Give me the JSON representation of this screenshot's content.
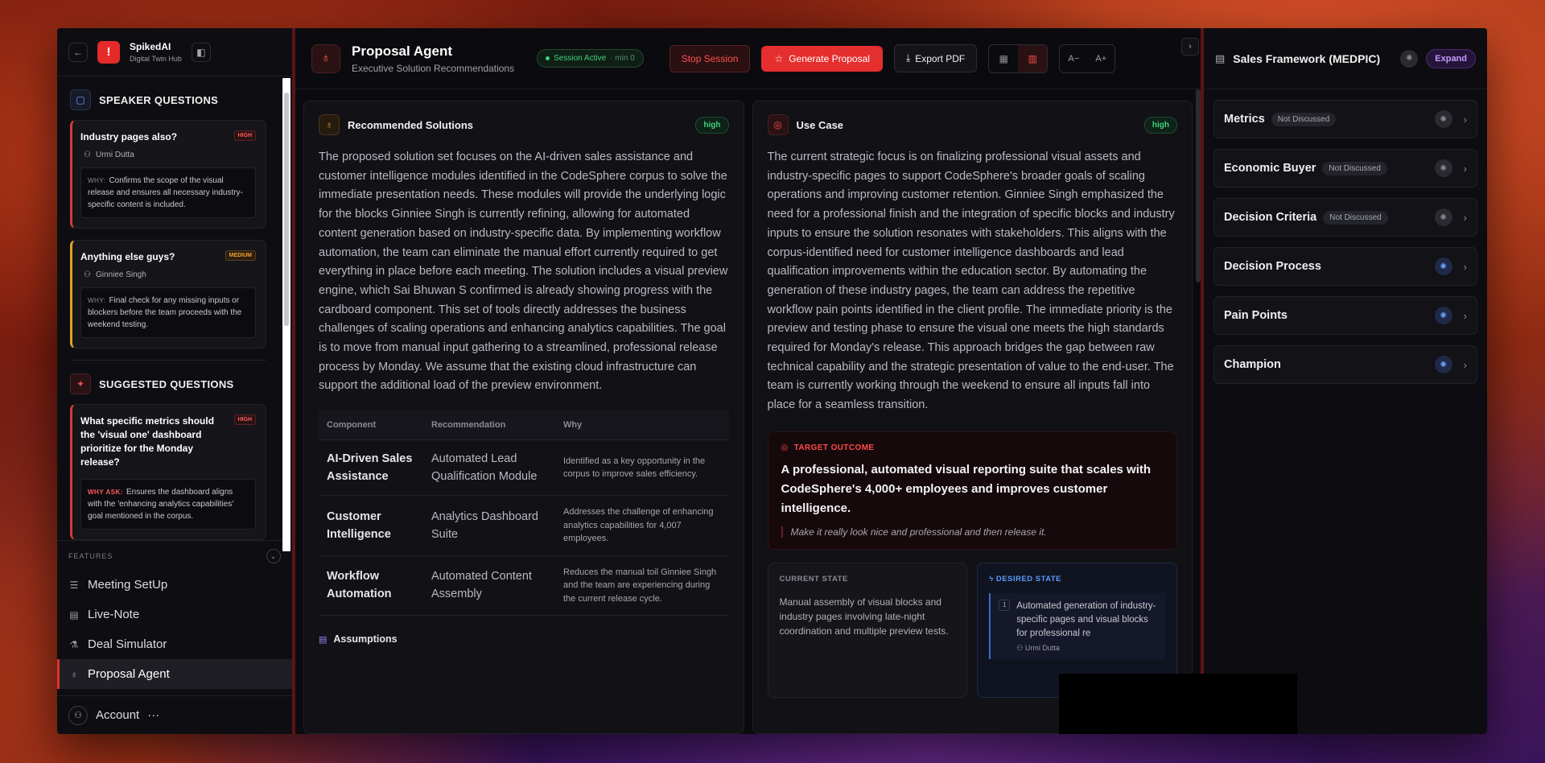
{
  "app": {
    "brand_name": "SpikedAI",
    "brand_sub": "Digital Twin Hub",
    "logo_glyph": "!"
  },
  "speaker_questions": {
    "title": "SPEAKER QUESTIONS",
    "items": [
      {
        "question": "Industry pages also?",
        "priority": "HIGH",
        "user": "Urmi Dutta",
        "why_label": "WHY:",
        "why": "Confirms the scope of the visual release and ensures all necessary industry-specific content is included."
      },
      {
        "question": "Anything else guys?",
        "priority": "MEDIUM",
        "user": "Ginniee Singh",
        "why_label": "WHY:",
        "why": "Final check for any missing inputs or blockers before the team proceeds with the weekend testing."
      }
    ]
  },
  "suggested_questions": {
    "title": "SUGGESTED QUESTIONS",
    "items": [
      {
        "question": "What specific metrics should the 'visual one' dashboard prioritize for the Monday release?",
        "priority": "HIGH",
        "why_label": "WHY ASK:",
        "why": "Ensures the dashboard aligns with the 'enhancing analytics capabilities' goal mentioned in the corpus."
      }
    ]
  },
  "features": {
    "label": "FEATURES",
    "items": [
      {
        "label": "Meeting SetUp",
        "icon": "database-icon"
      },
      {
        "label": "Live-Note",
        "icon": "message-icon"
      },
      {
        "label": "Deal Simulator",
        "icon": "flask-icon"
      },
      {
        "label": "Proposal Agent",
        "icon": "lightbulb-icon",
        "active": true
      }
    ]
  },
  "account": {
    "label": "Account",
    "more": "···"
  },
  "header": {
    "title": "Proposal Agent",
    "subtitle": "Executive Solution Recommendations",
    "session_status": "Session Active",
    "session_time": "· min 0",
    "stop_label": "Stop Session",
    "generate_label": "Generate Proposal",
    "export_label": "Export PDF",
    "font_decrease": "A−",
    "font_increase": "A+"
  },
  "recommended": {
    "title": "Recommended Solutions",
    "badge": "high",
    "paragraph": "The proposed solution set focuses on the AI-driven sales assistance and customer intelligence modules identified in the CodeSphere corpus to solve the immediate presentation needs. These modules will provide the underlying logic for the blocks Ginniee Singh is currently refining, allowing for automated content generation based on industry-specific data. By implementing workflow automation, the team can eliminate the manual effort currently required to get everything in place before each meeting. The solution includes a visual preview engine, which Sai Bhuwan S confirmed is already showing progress with the cardboard component. This set of tools directly addresses the business challenges of scaling operations and enhancing analytics capabilities. The goal is to move from manual input gathering to a streamlined, professional release process by Monday. We assume that the existing cloud infrastructure can support the additional load of the preview environment.",
    "table": {
      "headers": [
        "Component",
        "Recommendation",
        "Why"
      ],
      "rows": [
        {
          "component": "AI-Driven Sales Assistance",
          "recommendation": "Automated Lead Qualification Module",
          "why": "Identified as a key opportunity in the corpus to improve sales efficiency."
        },
        {
          "component": "Customer Intelligence",
          "recommendation": "Analytics Dashboard Suite",
          "why": "Addresses the challenge of enhancing analytics capabilities for 4,007 employees."
        },
        {
          "component": "Workflow Automation",
          "recommendation": "Automated Content Assembly",
          "why": "Reduces the manual toil Ginniee Singh and the team are experiencing during the current release cycle."
        }
      ]
    },
    "assumptions_label": "Assumptions"
  },
  "use_case": {
    "title": "Use Case",
    "badge": "high",
    "paragraph": "The current strategic focus is on finalizing professional visual assets and industry-specific pages to support CodeSphere's broader goals of scaling operations and improving customer retention. Ginniee Singh emphasized the need for a professional finish and the integration of specific blocks and industry inputs to ensure the solution resonates with stakeholders. This aligns with the corpus-identified need for customer intelligence dashboards and lead qualification improvements within the education sector. By automating the generation of these industry pages, the team can address the repetitive workflow pain points identified in the client profile. The immediate priority is the preview and testing phase to ensure the visual one meets the high standards required for Monday's release. This approach bridges the gap between raw technical capability and the strategic presentation of value to the end-user. The team is currently working through the weekend to ensure all inputs fall into place for a seamless transition.",
    "target_label": "TARGET OUTCOME",
    "target_text": "A professional, automated visual reporting suite that scales with CodeSphere's 4,000+ employees and improves customer intelligence.",
    "target_quote": "Make it really look nice and professional and then release it.",
    "current_label": "CURRENT STATE",
    "current_text": "Manual assembly of visual blocks and industry pages involving late-night coordination and multiple preview tests.",
    "desired_label": "DESIRED STATE",
    "desired_item_num": "1",
    "desired_item_text": "Automated generation of industry-specific pages and visual blocks for professional re",
    "desired_item_user": "Urmi Dutta"
  },
  "framework": {
    "title": "Sales Framework (MEDPIC)",
    "expand_label": "Expand",
    "items": [
      {
        "name": "Metrics",
        "status": "Not Discussed"
      },
      {
        "name": "Economic Buyer",
        "status": "Not Discussed"
      },
      {
        "name": "Decision Criteria",
        "status": "Not Discussed"
      },
      {
        "name": "Decision Process",
        "status": ""
      },
      {
        "name": "Pain Points",
        "status": ""
      },
      {
        "name": "Champion",
        "status": ""
      }
    ]
  }
}
